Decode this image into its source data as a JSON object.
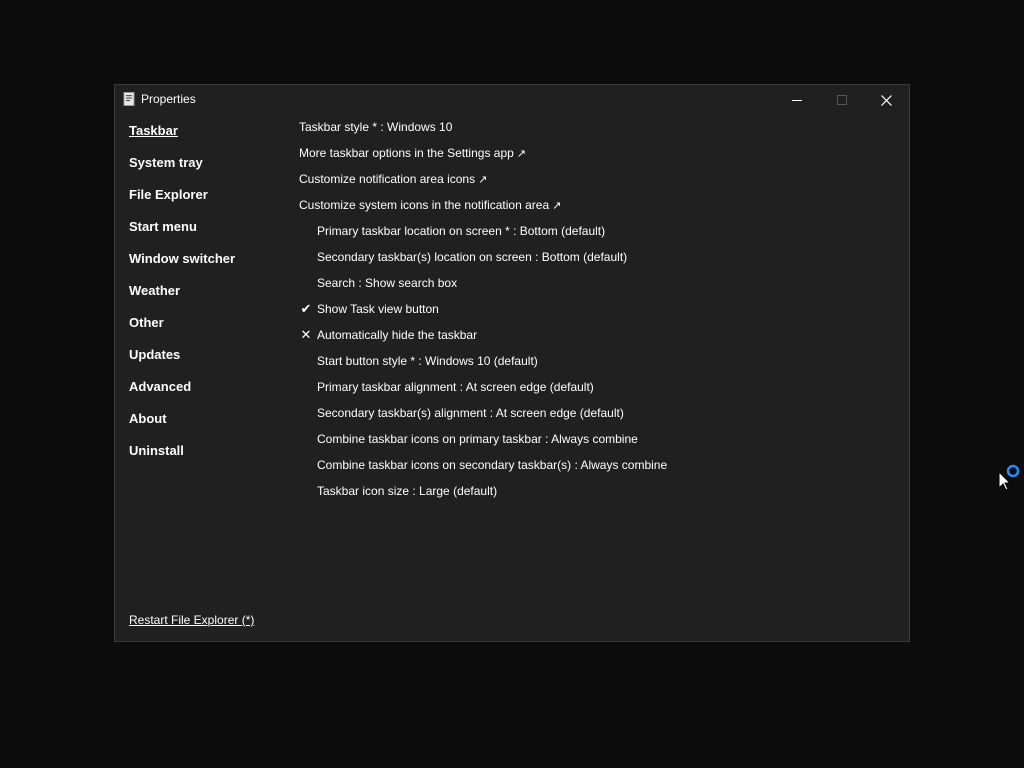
{
  "window": {
    "title": "Properties"
  },
  "sidebar": {
    "items": [
      {
        "label": "Taskbar",
        "active": true
      },
      {
        "label": "System tray"
      },
      {
        "label": "File Explorer"
      },
      {
        "label": "Start menu"
      },
      {
        "label": "Window switcher"
      },
      {
        "label": "Weather"
      },
      {
        "label": "Other"
      },
      {
        "label": "Updates"
      },
      {
        "label": "Advanced"
      },
      {
        "label": "About"
      },
      {
        "label": "Uninstall"
      }
    ],
    "restart_label": "Restart File Explorer (*)"
  },
  "options": [
    {
      "text": "Taskbar style * : Windows 10",
      "indent": false
    },
    {
      "text": "More taskbar options in the Settings app",
      "link": "↗",
      "indent": false
    },
    {
      "text": "Customize notification area icons",
      "link": "↗",
      "indent": false
    },
    {
      "text": "Customize system icons in the notification area",
      "link": "↗",
      "indent": false
    },
    {
      "text": "Primary taskbar location on screen * : Bottom (default)",
      "indent": true
    },
    {
      "text": "Secondary taskbar(s) location on screen : Bottom (default)",
      "indent": true
    },
    {
      "text": "Search : Show search box",
      "indent": true
    },
    {
      "text": "Show Task view button",
      "indent": true,
      "mark": "✔"
    },
    {
      "text": "Automatically hide the taskbar",
      "indent": true,
      "mark": "✕"
    },
    {
      "text": "Start button style * : Windows 10 (default)",
      "indent": true
    },
    {
      "text": "Primary taskbar alignment : At screen edge (default)",
      "indent": true
    },
    {
      "text": "Secondary taskbar(s) alignment : At screen edge (default)",
      "indent": true
    },
    {
      "text": "Combine taskbar icons on primary taskbar : Always combine",
      "indent": true
    },
    {
      "text": "Combine taskbar icons on secondary taskbar(s) : Always combine",
      "indent": true
    },
    {
      "text": "Taskbar icon size : Large (default)",
      "indent": true
    }
  ],
  "icons": {
    "app": "properties-app-icon",
    "minimize": "minimize-icon",
    "maximize": "maximize-icon",
    "close": "close-icon",
    "cursor": "busy-cursor-icon"
  },
  "colors": {
    "desktop": "#0c0c0c",
    "window_bg": "#202020",
    "text": "#ffffff",
    "busy_ring": "#1e90ff"
  }
}
